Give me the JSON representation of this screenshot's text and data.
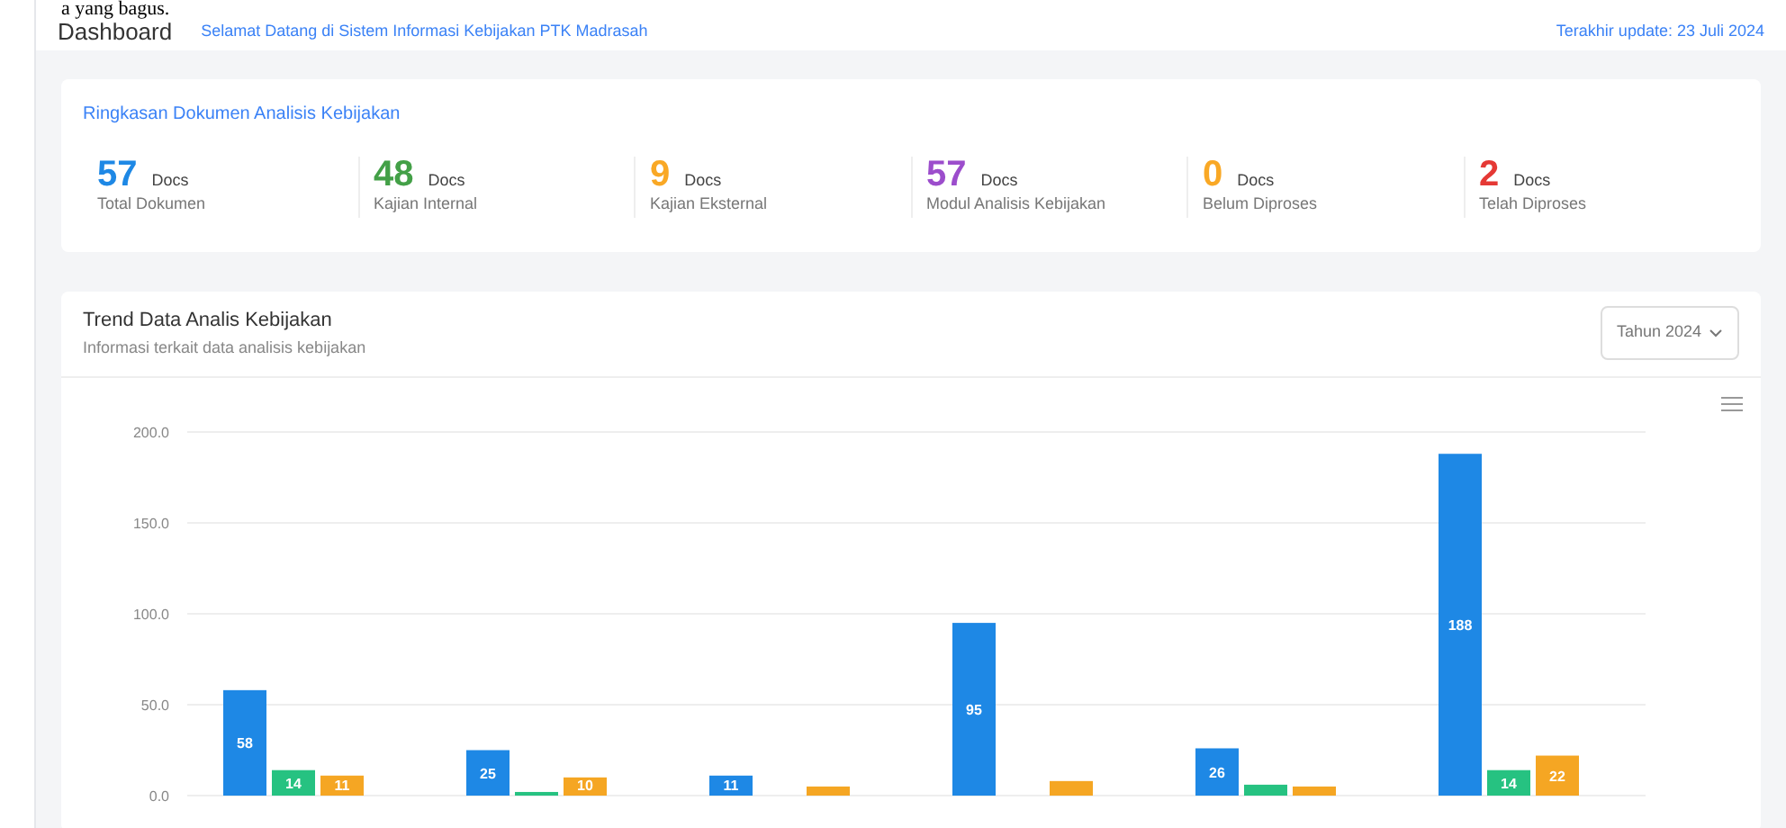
{
  "top_caption": "a yang bagus.",
  "header": {
    "title": "Dashboard",
    "breadcrumb": "Selamat Datang di Sistem Informasi Kebijakan PTK Madrasah",
    "meta": "Terakhir update: 23 Juli 2024"
  },
  "summary": {
    "title": "Ringkasan Dokumen Analisis Kebijakan",
    "stats": [
      {
        "value": "57",
        "unit": "Docs",
        "label": "Total Dokumen",
        "color": "#1e88e5"
      },
      {
        "value": "48",
        "unit": "Docs",
        "label": "Kajian Internal",
        "color": "#43a047"
      },
      {
        "value": "9",
        "unit": "Docs",
        "label": "Kajian Eksternal",
        "color": "#f9a825"
      },
      {
        "value": "57",
        "unit": "Docs",
        "label": "Modul Analisis Kebijakan",
        "color": "#9c4dcc"
      },
      {
        "value": "0",
        "unit": "Docs",
        "label": "Belum Diproses",
        "color": "#f9a825"
      },
      {
        "value": "2",
        "unit": "Docs",
        "label": "Telah Diproses",
        "color": "#e53935"
      }
    ]
  },
  "trend": {
    "title": "Trend Data Analis Kebijakan",
    "subtitle": "Informasi terkait data analisis kebijakan",
    "year_select": "Tahun 2024",
    "chart_data": {
      "type": "bar",
      "ylim": [
        0,
        200
      ],
      "yticks": [
        {
          "value": 0,
          "label": "0.0"
        },
        {
          "value": 50,
          "label": "50.0"
        },
        {
          "value": 100,
          "label": "100.0"
        },
        {
          "value": 150,
          "label": "150.0"
        },
        {
          "value": 200,
          "label": "200.0"
        }
      ],
      "grid": true,
      "value_labels": [
        [
          "58",
          "25",
          "11",
          "95",
          "26",
          "188"
        ],
        [
          "14",
          null,
          null,
          null,
          null,
          "14"
        ],
        [
          "11",
          "10",
          null,
          null,
          null,
          "22"
        ]
      ],
      "series": [
        {
          "color": "#1e88e5",
          "values": [
            58,
            25,
            11,
            95,
            26,
            188
          ]
        },
        {
          "color": "#26c281",
          "values": [
            14,
            2,
            0,
            0,
            6,
            14
          ]
        },
        {
          "color": "#f5a623",
          "values": [
            11,
            10,
            5,
            8,
            5,
            22
          ]
        }
      ]
    }
  }
}
